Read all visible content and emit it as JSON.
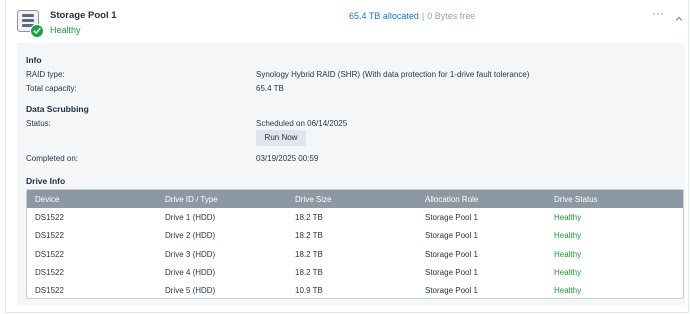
{
  "pool": {
    "title": "Storage Pool 1",
    "status": "Healthy",
    "allocated": "65.4 TB allocated",
    "separator": "|",
    "free": "0 Bytes free",
    "more_label": "···"
  },
  "info": {
    "title": "Info",
    "raid_type_label": "RAID type:",
    "raid_type_value": "Synology Hybrid RAID (SHR) (With data protection for 1-drive fault tolerance)",
    "capacity_label": "Total capacity:",
    "capacity_value": "65.4 TB"
  },
  "scrubbing": {
    "title": "Data Scrubbing",
    "status_label": "Status:",
    "status_value": "Scheduled on 06/14/2025",
    "run_now_label": "Run Now",
    "completed_label": "Completed on:",
    "completed_value": "03/19/2025 00:59"
  },
  "drive_info": {
    "title": "Drive Info",
    "columns": [
      "Device",
      "Drive ID / Type",
      "Drive Size",
      "Allocation Role",
      "Drive Status"
    ],
    "rows": [
      [
        "DS1522",
        "Drive 1 (HDD)",
        "18.2 TB",
        "Storage Pool 1",
        "Healthy"
      ],
      [
        "DS1522",
        "Drive 2 (HDD)",
        "18.2 TB",
        "Storage Pool 1",
        "Healthy"
      ],
      [
        "DS1522",
        "Drive 3 (HDD)",
        "18.2 TB",
        "Storage Pool 1",
        "Healthy"
      ],
      [
        "DS1522",
        "Drive 4 (HDD)",
        "18.2 TB",
        "Storage Pool 1",
        "Healthy"
      ],
      [
        "DS1522",
        "Drive 5 (HDD)",
        "10.9 TB",
        "Storage Pool 1",
        "Healthy"
      ]
    ]
  },
  "colors": {
    "healthy": "#1a9a32",
    "allocated_link": "#1278d0",
    "table_header_bg": "#8c98a4",
    "panel_bg": "#f4f6f8"
  },
  "icons": {
    "pool": "storage-pool-icon",
    "status": "check-badge-icon",
    "more": "more-icon",
    "collapse": "chevron-up-icon"
  }
}
